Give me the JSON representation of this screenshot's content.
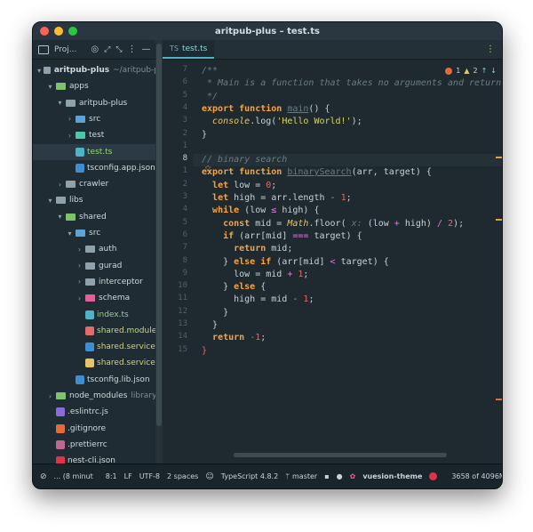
{
  "window": {
    "title": "aritpub-plus – test.ts",
    "lights": [
      "#ff5f57",
      "#febc2e",
      "#28c840"
    ]
  },
  "project_panel": {
    "header_label": "Proj...",
    "tree": [
      {
        "label": "aritpub-plus",
        "suffix": "~/aritpub-p",
        "type": "folder",
        "depth": 0,
        "open": true,
        "color": "#8fa1aa"
      },
      {
        "label": "apps",
        "type": "folder",
        "depth": 1,
        "open": true,
        "color": "#7bc46b"
      },
      {
        "label": "aritpub-plus",
        "type": "folder",
        "depth": 2,
        "open": true,
        "color": "#8fa1aa"
      },
      {
        "label": "src",
        "type": "folder",
        "depth": 3,
        "open": false,
        "color": "#5aa4d9"
      },
      {
        "label": "test",
        "type": "folder",
        "depth": 3,
        "open": false,
        "color": "#48c9a9"
      },
      {
        "label": "test.ts",
        "type": "file",
        "depth": 3,
        "color": "#9bd37a",
        "icon_color": "#4fb3c8",
        "selected": true
      },
      {
        "label": "tsconfig.app.json",
        "type": "file",
        "depth": 3,
        "color": "#d0d9dd",
        "icon_color": "#3e8ed0"
      },
      {
        "label": "crawler",
        "type": "folder",
        "depth": 2,
        "open": false,
        "color": "#8fa1aa"
      },
      {
        "label": "libs",
        "type": "folder",
        "depth": 1,
        "open": true,
        "color": "#8fa1aa"
      },
      {
        "label": "shared",
        "type": "folder",
        "depth": 2,
        "open": true,
        "color": "#7bc46b"
      },
      {
        "label": "src",
        "type": "folder",
        "depth": 3,
        "open": true,
        "color": "#5aa4d9"
      },
      {
        "label": "auth",
        "type": "folder",
        "depth": 4,
        "open": false,
        "color": "#8fa1aa"
      },
      {
        "label": "gurad",
        "type": "folder",
        "depth": 4,
        "open": false,
        "color": "#8fa1aa"
      },
      {
        "label": "interceptor",
        "type": "folder",
        "depth": 4,
        "open": false,
        "color": "#8fa1aa"
      },
      {
        "label": "schema",
        "type": "folder",
        "depth": 4,
        "open": false,
        "color": "#e0609a"
      },
      {
        "label": "index.ts",
        "type": "file",
        "depth": 4,
        "color": "#9bd37a",
        "icon_color": "#4fb3c8"
      },
      {
        "label": "shared.module.t",
        "type": "file",
        "depth": 4,
        "color": "#d7d36b",
        "icon_color": "#e26b6b"
      },
      {
        "label": "shared.service.s",
        "type": "file",
        "depth": 4,
        "color": "#d7d36b",
        "icon_color": "#3e8ed0"
      },
      {
        "label": "shared.service.ts",
        "type": "file",
        "depth": 4,
        "color": "#d7d36b",
        "icon_color": "#e3c567"
      },
      {
        "label": "tsconfig.lib.json",
        "type": "file",
        "depth": 3,
        "color": "#d0d9dd",
        "icon_color": "#3e8ed0"
      },
      {
        "label": "node_modules",
        "suffix": "library ro",
        "type": "folder",
        "depth": 1,
        "open": false,
        "color": "#7bc46b"
      },
      {
        "label": ".eslintrc.js",
        "type": "file",
        "depth": 1,
        "color": "#d0d9dd",
        "icon_color": "#8b6bd9"
      },
      {
        "label": ".gitignore",
        "type": "file",
        "depth": 1,
        "color": "#d0d9dd",
        "icon_color": "#e26b3a"
      },
      {
        "label": ".prettierrc",
        "type": "file",
        "depth": 1,
        "color": "#d0d9dd",
        "icon_color": "#c3658f"
      },
      {
        "label": "nest-cli.json",
        "type": "file",
        "depth": 1,
        "color": "#d0d9dd",
        "icon_color": "#e0334a"
      }
    ]
  },
  "editor": {
    "tab_label": "test.ts",
    "inspections": {
      "errors": "1",
      "warnings": "2"
    },
    "line_numbers": [
      "7",
      "6",
      "5",
      "4",
      "3",
      "2",
      "1",
      "8",
      "1",
      "2",
      "3",
      "4",
      "5",
      "6",
      "7",
      "8",
      "9",
      "10",
      "11",
      "12",
      "13",
      "14",
      "15"
    ],
    "current_line_index": 7,
    "code_lines": [
      [
        {
          "t": "/**",
          "c": "cm"
        }
      ],
      [
        {
          "t": " * Main is a function that takes no arguments and returns no",
          "c": "cm"
        }
      ],
      [
        {
          "t": " */",
          "c": "cm"
        }
      ],
      [
        {
          "t": "export function ",
          "c": "kw"
        },
        {
          "t": "main",
          "c": "hint"
        },
        {
          "t": "() {",
          "c": ""
        }
      ],
      [
        {
          "t": "  ",
          "c": ""
        },
        {
          "t": "console",
          "c": "italic-fn"
        },
        {
          "t": ".log(",
          "c": ""
        },
        {
          "t": "'Hello World!'",
          "c": "str"
        },
        {
          "t": ");",
          "c": ""
        }
      ],
      [
        {
          "t": "}",
          "c": ""
        }
      ],
      [],
      [
        {
          "t": "// binary search",
          "c": "cm"
        }
      ],
      [
        {
          "t": "export function ",
          "c": "kw"
        },
        {
          "t": "binarySearch",
          "c": "hint"
        },
        {
          "t": "(arr, target) {",
          "c": ""
        }
      ],
      [
        {
          "t": "  ",
          "c": ""
        },
        {
          "t": "let",
          "c": "kw"
        },
        {
          "t": " low = ",
          "c": ""
        },
        {
          "t": "0",
          "c": "num"
        },
        {
          "t": ";",
          "c": ""
        }
      ],
      [
        {
          "t": "  ",
          "c": ""
        },
        {
          "t": "let",
          "c": "kw"
        },
        {
          "t": " high = arr.length ",
          "c": ""
        },
        {
          "t": "-",
          "c": "op"
        },
        {
          "t": " ",
          "c": ""
        },
        {
          "t": "1",
          "c": "num"
        },
        {
          "t": ";",
          "c": ""
        }
      ],
      [
        {
          "t": "  ",
          "c": ""
        },
        {
          "t": "while",
          "c": "kw"
        },
        {
          "t": " (low ",
          "c": ""
        },
        {
          "t": "≤",
          "c": "op"
        },
        {
          "t": " high) {",
          "c": ""
        }
      ],
      [
        {
          "t": "    ",
          "c": ""
        },
        {
          "t": "const",
          "c": "kw"
        },
        {
          "t": " mid = ",
          "c": ""
        },
        {
          "t": "Math",
          "c": "italic-fn"
        },
        {
          "t": ".floor(",
          "c": ""
        },
        {
          "t": " x:",
          "c": "cm"
        },
        {
          "t": " (low ",
          "c": ""
        },
        {
          "t": "+",
          "c": "op"
        },
        {
          "t": " high) ",
          "c": ""
        },
        {
          "t": "/",
          "c": "op"
        },
        {
          "t": " ",
          "c": ""
        },
        {
          "t": "2",
          "c": "num"
        },
        {
          "t": ");",
          "c": ""
        }
      ],
      [
        {
          "t": "    ",
          "c": ""
        },
        {
          "t": "if",
          "c": "kw"
        },
        {
          "t": " (arr[mid] ",
          "c": ""
        },
        {
          "t": "===",
          "c": "op"
        },
        {
          "t": " target) {",
          "c": ""
        }
      ],
      [
        {
          "t": "      ",
          "c": ""
        },
        {
          "t": "return",
          "c": "kw"
        },
        {
          "t": " mid;",
          "c": ""
        }
      ],
      [
        {
          "t": "    } ",
          "c": ""
        },
        {
          "t": "else if",
          "c": "kw"
        },
        {
          "t": " (arr[mid] ",
          "c": ""
        },
        {
          "t": "<",
          "c": "op"
        },
        {
          "t": " target) {",
          "c": ""
        }
      ],
      [
        {
          "t": "      low = mid ",
          "c": ""
        },
        {
          "t": "+",
          "c": "op"
        },
        {
          "t": " ",
          "c": ""
        },
        {
          "t": "1",
          "c": "num"
        },
        {
          "t": ";",
          "c": ""
        }
      ],
      [
        {
          "t": "    } ",
          "c": ""
        },
        {
          "t": "else",
          "c": "kw"
        },
        {
          "t": " {",
          "c": ""
        }
      ],
      [
        {
          "t": "      high = mid ",
          "c": ""
        },
        {
          "t": "-",
          "c": "op"
        },
        {
          "t": " ",
          "c": ""
        },
        {
          "t": "1",
          "c": "num"
        },
        {
          "t": ";",
          "c": ""
        }
      ],
      [
        {
          "t": "    }",
          "c": ""
        }
      ],
      [
        {
          "t": "  }",
          "c": ""
        }
      ],
      [
        {
          "t": "  ",
          "c": ""
        },
        {
          "t": "return",
          "c": "kw"
        },
        {
          "t": " ",
          "c": ""
        },
        {
          "t": "-1",
          "c": "num"
        },
        {
          "t": ";",
          "c": ""
        }
      ],
      [
        {
          "t": "}",
          "c": "num"
        }
      ]
    ]
  },
  "status_bar": {
    "task": "... (8 minut",
    "position": "8:1",
    "line_ending": "LF",
    "encoding": "UTF-8",
    "indent": "2 spaces",
    "language": "TypeScript 4.8.2",
    "branch": "master",
    "theme": "vuesion-theme",
    "memory": "3658 of 4096M"
  }
}
